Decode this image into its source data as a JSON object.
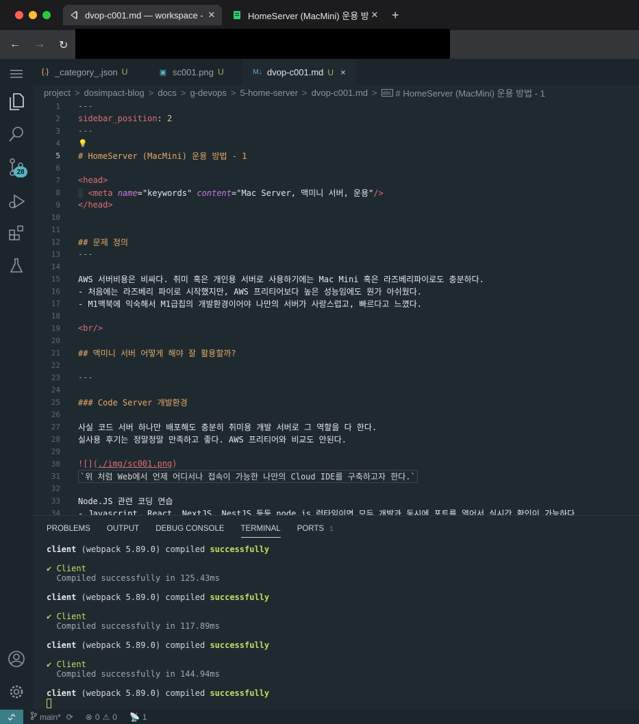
{
  "browser": {
    "tabs": [
      {
        "title": "dvop-c001.md — workspace -",
        "active": true,
        "icon": "vscode-icon"
      },
      {
        "title": "HomeServer (MacMini) 운용 방...",
        "active": false,
        "icon": "document-icon"
      }
    ],
    "new_tab": "+",
    "nav": {
      "back": "←",
      "forward": "→",
      "reload": "↻"
    }
  },
  "editor_tabs": [
    {
      "name": "_category_.json",
      "icon": "{.}",
      "modified": "U"
    },
    {
      "name": "sc001.png",
      "icon": "▣",
      "modified": "U"
    },
    {
      "name": "dvop-c001.md",
      "icon": "M↓",
      "modified": "U",
      "close": "×"
    }
  ],
  "breadcrumb": [
    "project",
    "dosimpact-blog",
    "docs",
    "g-devops",
    "5-home-server",
    "dvop-c001.md",
    "# HomeServer (MacMini) 운용 방법 - 1"
  ],
  "breadcrumb_sep": ">",
  "lines": {
    "l1": "---",
    "l2_key": "sidebar_position",
    "l2_colon": ": ",
    "l2_val": "2",
    "l3": "---",
    "l5": "# HomeServer (MacMini) 운용 방법 - 1",
    "l7": "<head>",
    "l8_open": "<meta ",
    "l8_name_attr": "name",
    "l8_name_val": "=\"keywords\" ",
    "l8_content_attr": "content",
    "l8_content_val": "=\"Mac Server, 맥미니 서버, 운용\"",
    "l8_close": "/>",
    "l9": "</head>",
    "l12": "## 문제 정의",
    "l13": "---",
    "l15": "AWS 서버비용은 비싸다. 취미 혹은 개인용 서버로 사용하기에는 Mac Mini 혹은 라즈베리파이로도 충분하다.",
    "l16": "- 처음에는 라즈베리 파이로 시작했지만, AWS 프리티어보다 높은 성능임에도 뭔가 아쉬웠다.",
    "l17": "- M1맥북에 익숙해서 M1급칩의 개발환경이어야 나만의 서버가 사랑스럽고, 빠르다고 느꼈다.",
    "l19": "<br/>",
    "l21": "## 맥미니 서버 어떻게 해야 잘 활용할까?",
    "l23": "---",
    "l25": "### Code Server 개발환경",
    "l27": "사실 코드 서버 하나만 배포해도 충분히 취미용 개발 서버로 그 역할을 다 한다.",
    "l28": "실사용 후기는 정말정말 만족하고 좋다. AWS 프리티어와 비교도 안된다.",
    "l30_pre": "![](",
    "l30_link": "./img/sc001.png",
    "l30_post": ")",
    "l31": "`위 처럼 Web에서 언제 어디서나 접속이 가능한 나만의 Cloud IDE를 구축하고자 한다.`",
    "l33": "Node.JS 관련 코딩 연습",
    "l34": "- Javascript, React, NextJS, NestJS 등등 node.js 런타임이면 모두 개발과 동시에 포트를 열어서 실시간 확인이 가능하다."
  },
  "line_numbers": [
    "1",
    "2",
    "3",
    "4",
    "5",
    "6",
    "7",
    "8",
    "9",
    "10",
    "11",
    "12",
    "13",
    "14",
    "15",
    "16",
    "17",
    "18",
    "19",
    "20",
    "21",
    "22",
    "23",
    "24",
    "25",
    "26",
    "27",
    "28",
    "29",
    "30",
    "31",
    "32",
    "33",
    "34"
  ],
  "lightbulb": "💡",
  "panel": {
    "tabs": [
      "PROBLEMS",
      "OUTPUT",
      "DEBUG CONSOLE",
      "TERMINAL",
      "PORTS"
    ],
    "ports_count": "1",
    "active_tab": "TERMINAL"
  },
  "terminal": {
    "client_word": "client",
    "compiled_msg": " (webpack 5.89.0) compiled ",
    "success_word": "successfully",
    "check": "✔ Client",
    "times": [
      "Compiled successfully in 125.43ms",
      "Compiled successfully in 117.89ms",
      "Compiled successfully in 144.94ms"
    ]
  },
  "status": {
    "branch": "main*",
    "sync": "⟳",
    "errors": "0",
    "warnings": "0",
    "ports": "1"
  }
}
